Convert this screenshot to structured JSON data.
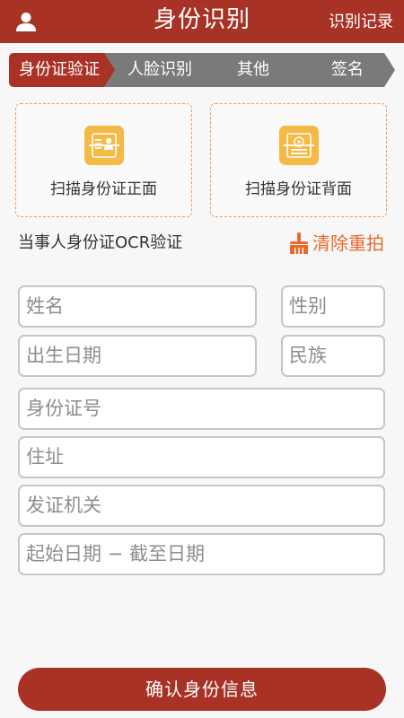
{
  "header": {
    "title": "身份识别",
    "records_link": "识别记录",
    "user_icon": "user-icon"
  },
  "steps": [
    {
      "label": "身份证验证",
      "active": true
    },
    {
      "label": "人脸识别",
      "active": false
    },
    {
      "label": "其他",
      "active": false
    },
    {
      "label": "签名",
      "active": false
    }
  ],
  "scan": {
    "front_label": "扫描身份证正面",
    "back_label": "扫描身份证背面",
    "front_icon": "id-card-front-icon",
    "back_icon": "id-card-back-icon"
  },
  "ocr": {
    "section_title": "当事人身份证OCR验证",
    "clear_label": "清除重拍",
    "clear_icon": "broom-icon"
  },
  "form": {
    "name_placeholder": "姓名",
    "gender_placeholder": "性别",
    "birth_placeholder": "出生日期",
    "ethnicity_placeholder": "民族",
    "id_number_placeholder": "身份证号",
    "address_placeholder": "住址",
    "authority_placeholder": "发证机关",
    "validity_placeholder": "起始日期 − 截至日期"
  },
  "confirm_label": "确认身份信息",
  "colors": {
    "brand": "#a83226",
    "accent_orange": "#e9692c",
    "step_inactive": "#7a7a7a",
    "icon_yellow": "#f5b945"
  }
}
